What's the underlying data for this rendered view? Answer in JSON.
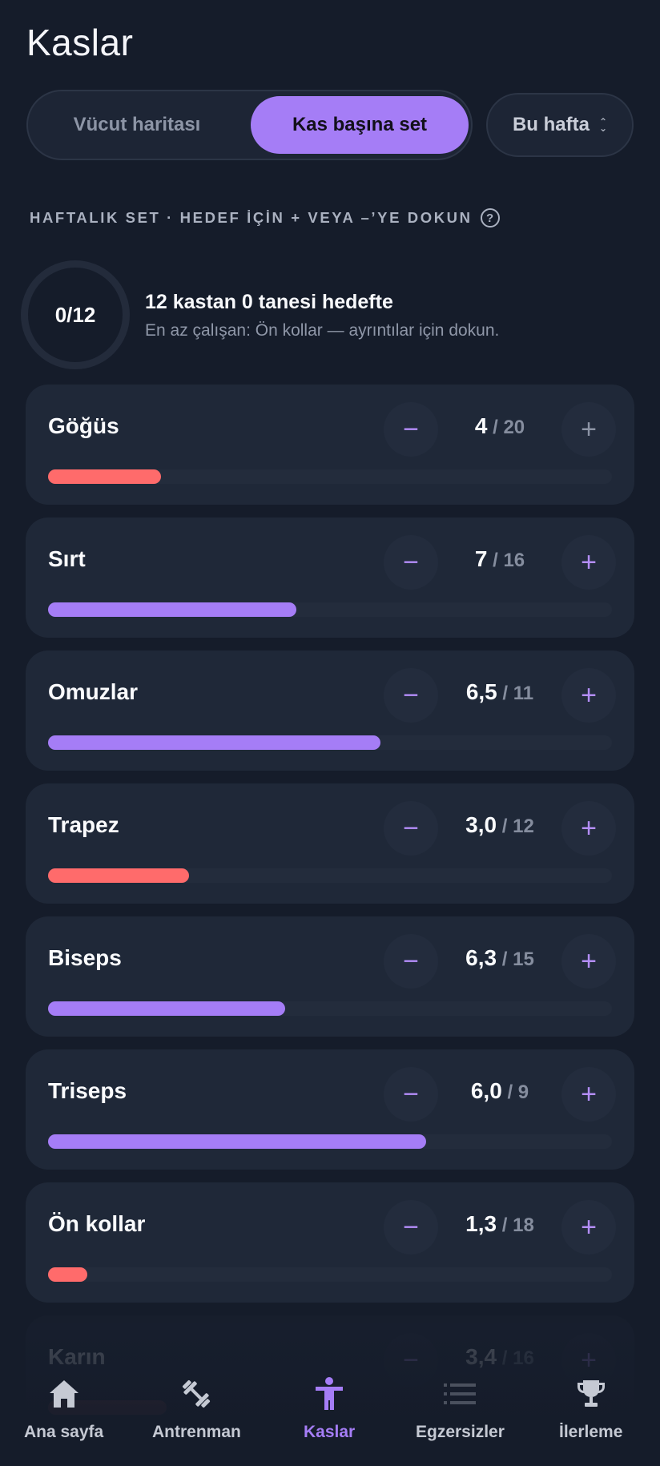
{
  "header": {
    "title": "Kaslar"
  },
  "segmented": {
    "option_map": "Vücut haritası",
    "option_sets": "Kas başına set",
    "selected": "Kas başına set"
  },
  "period": {
    "label": "Bu hafta"
  },
  "section": {
    "heading": "HAFTALIK SET · HEDEF İÇİN + VEYA –’YE DOKUN"
  },
  "summary": {
    "ring_label": "0/12",
    "title": "12 kastan 0 tanesi hedefte",
    "subtitle": "En az çalışan: Ön kollar — ayrıntılar için dokun."
  },
  "colors": {
    "accent": "#a57df6",
    "under": "#ff6b6b",
    "background": "#151c2a",
    "card": "#1f2838"
  },
  "muscles": [
    {
      "name": "Göğüs",
      "value": "4",
      "target": "20",
      "progress": 0.2,
      "status": "under"
    },
    {
      "name": "Sırt",
      "value": "7",
      "target": "16",
      "progress": 0.44,
      "status": "ok"
    },
    {
      "name": "Omuzlar",
      "value": "6,5",
      "target": "11",
      "progress": 0.59,
      "status": "ok"
    },
    {
      "name": "Trapez",
      "value": "3,0",
      "target": "12",
      "progress": 0.25,
      "status": "under"
    },
    {
      "name": "Biseps",
      "value": "6,3",
      "target": "15",
      "progress": 0.42,
      "status": "ok"
    },
    {
      "name": "Triseps",
      "value": "6,0",
      "target": "9",
      "progress": 0.67,
      "status": "ok"
    },
    {
      "name": "Ön kollar",
      "value": "1,3",
      "target": "18",
      "progress": 0.07,
      "status": "under"
    },
    {
      "name": "Karın",
      "value": "3,4",
      "target": "16",
      "progress": 0.21,
      "status": "under"
    }
  ],
  "stepper": {
    "minus": "−",
    "plus": "+"
  },
  "tabbar": {
    "items": [
      {
        "label": "Ana sayfa",
        "icon": "home-icon"
      },
      {
        "label": "Antrenman",
        "icon": "dumbbell-icon"
      },
      {
        "label": "Kaslar",
        "icon": "person-icon",
        "active": true
      },
      {
        "label": "Egzersizler",
        "icon": "list-icon"
      },
      {
        "label": "İlerleme",
        "icon": "trophy-icon"
      }
    ]
  }
}
